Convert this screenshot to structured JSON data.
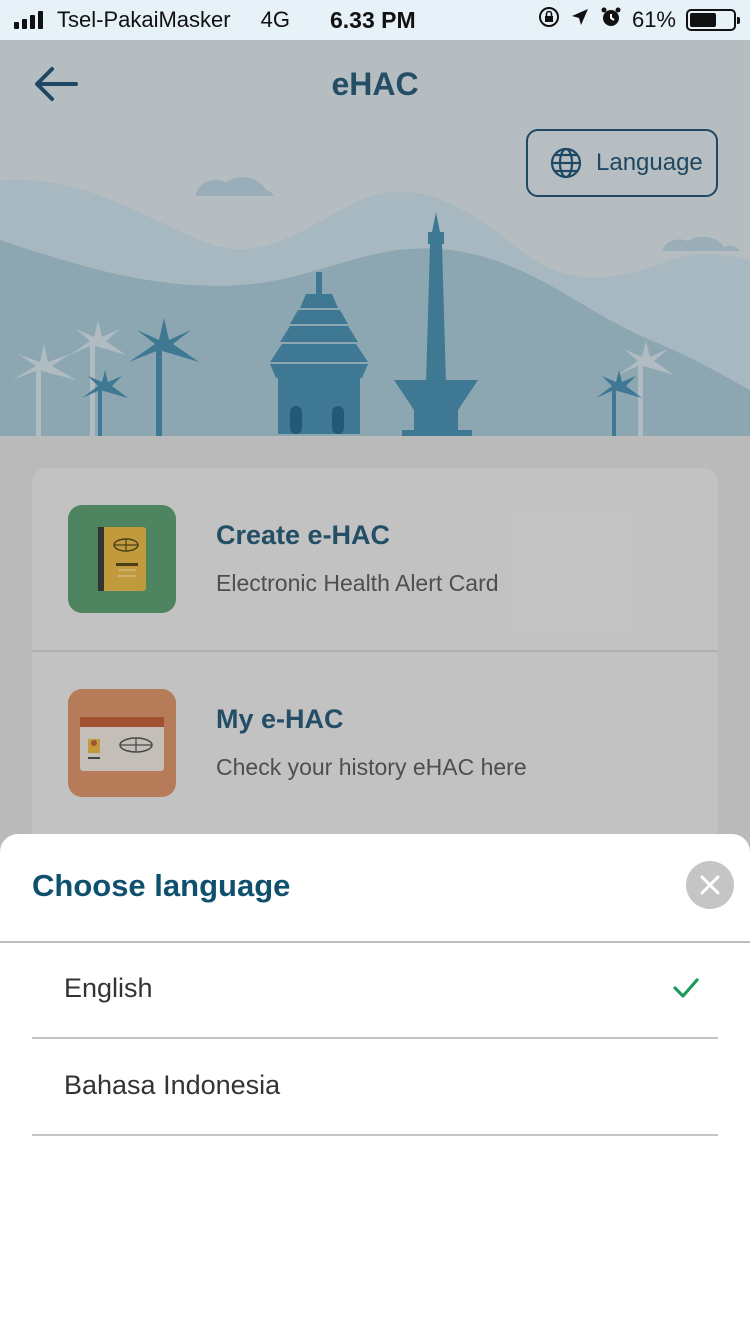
{
  "status_bar": {
    "carrier": "Tsel-PakaiMasker",
    "network": "4G",
    "time": "6.33 PM",
    "battery": "61%",
    "battery_level": 0.61
  },
  "header": {
    "title": "eHAC",
    "back_icon": "arrow-left-icon",
    "language_button": "Language",
    "language_icon": "globe-icon"
  },
  "menu": {
    "items": [
      {
        "title": "Create e-HAC",
        "subtitle": "Electronic Health Alert Card",
        "icon": "passport-book-icon",
        "color": "#5e9e72"
      },
      {
        "title": "My e-HAC",
        "subtitle": "Check your history eHAC here",
        "icon": "id-card-icon",
        "color": "#d9936a"
      }
    ]
  },
  "language_sheet": {
    "title": "Choose language",
    "close_icon": "close-icon",
    "options": [
      {
        "label": "English",
        "selected": true
      },
      {
        "label": "Bahasa Indonesia",
        "selected": false
      }
    ]
  },
  "colors": {
    "accent": "#10506f",
    "check": "#1f9a5a",
    "hero_sky": "#cfe3ec"
  }
}
